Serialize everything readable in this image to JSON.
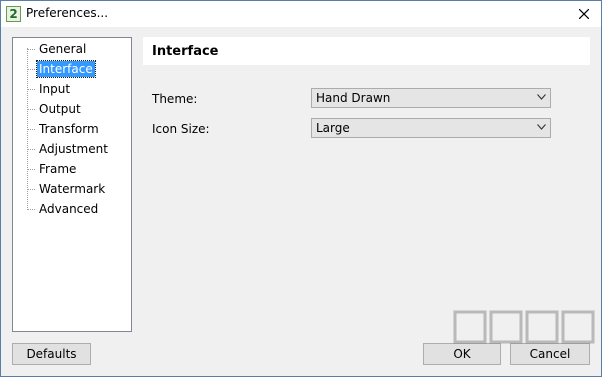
{
  "window": {
    "title": "Preferences...",
    "app_icon_glyph": "2",
    "close_icon": "close-icon"
  },
  "sidebar": {
    "items": [
      {
        "label": "General",
        "selected": false
      },
      {
        "label": "Interface",
        "selected": true
      },
      {
        "label": "Input",
        "selected": false
      },
      {
        "label": "Output",
        "selected": false
      },
      {
        "label": "Transform",
        "selected": false
      },
      {
        "label": "Adjustment",
        "selected": false
      },
      {
        "label": "Frame",
        "selected": false
      },
      {
        "label": "Watermark",
        "selected": false
      },
      {
        "label": "Advanced",
        "selected": false
      }
    ]
  },
  "panel": {
    "title": "Interface",
    "fields": [
      {
        "label": "Theme:",
        "value": "Hand Drawn"
      },
      {
        "label": "Icon Size:",
        "value": "Large"
      }
    ]
  },
  "buttons": {
    "defaults": "Defaults",
    "ok": "OK",
    "cancel": "Cancel"
  },
  "colors": {
    "selection": "#3399ff",
    "window_border": "#5a7ea8",
    "background": "#f0f0f0"
  }
}
